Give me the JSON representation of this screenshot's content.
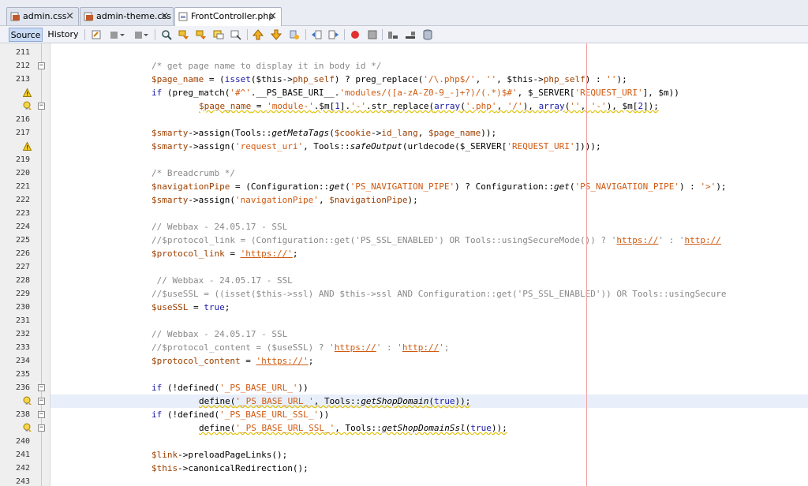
{
  "tabs": [
    {
      "label": "admin.css",
      "close": "×",
      "active": false
    },
    {
      "label": "admin-theme.css",
      "close": "×",
      "active": false
    },
    {
      "label": "FrontController.php",
      "close": "×",
      "active": true
    }
  ],
  "toolbar": {
    "source_label": "Source",
    "history_label": "History",
    "icons": [
      "last-edit-icon",
      "back-icon",
      "forward-icon",
      "find-selection-icon",
      "find-previous-icon",
      "find-next-icon",
      "toggle-highlight-icon",
      "toggle-rectangular-icon",
      "previous-bookmark-icon",
      "next-bookmark-icon",
      "toggle-bookmark-icon",
      "shift-left-icon",
      "shift-right-icon",
      "start-macro-icon",
      "stop-macro-icon",
      "comment-icon",
      "uncomment-icon",
      "database-icon"
    ]
  },
  "editor": {
    "line_numbers": [
      "211",
      "212",
      "213",
      "",
      "",
      "216",
      "217",
      "",
      "219",
      "220",
      "221",
      "222",
      "223",
      "224",
      "225",
      "226",
      "227",
      "228",
      "229",
      "230",
      "231",
      "232",
      "233",
      "234",
      "235",
      "236",
      "",
      "238",
      "",
      "240",
      "241",
      "242",
      "243"
    ],
    "warnings_lines": [
      3,
      7
    ],
    "hint_lines": [
      4,
      26,
      28
    ],
    "fold_lines": [
      1,
      4,
      25,
      26,
      27,
      28
    ]
  },
  "code": {
    "l211": "",
    "l212": "/* get page name to display it in body id */",
    "l213_a": "$page_name",
    "l213_b": " = (",
    "l213_c": "isset",
    "l213_d": "($this->",
    "l213_e": "php_self",
    "l213_f": ") ? preg_replace(",
    "l213_g": "'/\\.php$/'",
    "l213_h": ", ",
    "l213_i": "''",
    "l213_j": ", $this->",
    "l213_k": "php_self",
    "l213_l": ") : ",
    "l213_m": "''",
    "l213_n": ");",
    "l214_a": "if",
    "l214_b": " (preg_match(",
    "l214_c": "'#^'",
    "l214_d": ".__PS_BASE_URI__.",
    "l214_e": "'modules/([a-zA-Z0-9_-]+?)/(.*)$#'",
    "l214_f": ", $_SERVER[",
    "l214_g": "'REQUEST_URI'",
    "l214_h": "], $m))",
    "l215_a": "$page_name",
    "l215_b": " = ",
    "l215_c": "'module-'",
    "l215_d": ".$m[",
    "l215_e": "1",
    "l215_f": "].",
    "l215_g": "'-'",
    "l215_h": ".str_replace(",
    "l215_i": "array",
    "l215_j": "(",
    "l215_k": "'.php'",
    "l215_l": ", ",
    "l215_m": "'/'",
    "l215_n": "), ",
    "l215_o": "array",
    "l215_p": "(",
    "l215_q": "''",
    "l215_r": ", ",
    "l215_s": "'-'",
    "l215_t": "), $m[",
    "l215_u": "2",
    "l215_v": "]);",
    "l217_a": "$smarty",
    "l217_b": "->assign(Tools::",
    "l217_c": "getMetaTags",
    "l217_d": "(",
    "l217_e": "$cookie",
    "l217_f": "->",
    "l217_g": "id_lang",
    "l217_h": ", ",
    "l217_i": "$page_name",
    "l217_j": "));",
    "l218_a": "$smarty",
    "l218_b": "->assign(",
    "l218_c": "'request_uri'",
    "l218_d": ", Tools::",
    "l218_e": "safeOutput",
    "l218_f": "(urldecode($_SERVER[",
    "l218_g": "'REQUEST_URI'",
    "l218_h": "])));",
    "l220": "/* Breadcrumb */",
    "l221_a": "$navigationPipe",
    "l221_b": " = (Configuration::",
    "l221_c": "get",
    "l221_d": "(",
    "l221_e": "'PS_NAVIGATION_PIPE'",
    "l221_f": ") ? Configuration::",
    "l221_g": "get",
    "l221_h": "(",
    "l221_i": "'PS_NAVIGATION_PIPE'",
    "l221_j": ") : ",
    "l221_k": "'>'",
    "l221_l": ");",
    "l222_a": "$smarty",
    "l222_b": "->assign(",
    "l222_c": "'navigationPipe'",
    "l222_d": ", ",
    "l222_e": "$navigationPipe",
    "l222_f": ");",
    "l224": "// Webbax - 24.05.17 - SSL",
    "l225_a": "//$protocol_link = (Configuration::get('PS_SSL_ENABLED') OR Tools::usingSecureMode()) ? '",
    "l225_b": "https://",
    "l225_c": "' : '",
    "l225_d": "http://",
    "l226_a": "$protocol_link",
    "l226_b": " = ",
    "l226_c": "'https://'",
    "l226_d": ";",
    "l228": " // Webbax - 24.05.17 - SSL",
    "l229": "//$useSSL = ((isset($this->ssl) AND $this->ssl AND Configuration::get('PS_SSL_ENABLED')) OR Tools::usingSecure",
    "l230_a": "$useSSL",
    "l230_b": " = ",
    "l230_c": "true",
    "l230_d": ";",
    "l232": "// Webbax - 24.05.17 - SSL",
    "l233_a": "//$protocol_content = ($useSSL) ? '",
    "l233_b": "https://",
    "l233_c": "' : '",
    "l233_d": "http://",
    "l233_e": "';",
    "l234_a": "$protocol_content",
    "l234_b": " = ",
    "l234_c": "'https://'",
    "l234_d": ";",
    "l236_a": "if",
    "l236_b": " (!defined(",
    "l236_c": "'_PS_BASE_URL_'",
    "l236_d": "))",
    "l237_a": "define(",
    "l237_b": "'_PS_BASE_URL_'",
    "l237_c": ", Tools::",
    "l237_d": "getShopDomain",
    "l237_e": "(",
    "l237_f": "true",
    "l237_g": "));",
    "l238_a": "if",
    "l238_b": " (!defined(",
    "l238_c": "'_PS_BASE_URL_SSL_'",
    "l238_d": "))",
    "l239_a": "define(",
    "l239_b": "'_PS_BASE_URL_SSL_'",
    "l239_c": ", Tools::",
    "l239_d": "getShopDomainSsl",
    "l239_e": "(",
    "l239_f": "true",
    "l239_g": "));",
    "l241_a": "$link",
    "l241_b": "->preloadPageLinks();",
    "l242_a": "$this",
    "l242_b": "->canonicalRedirection();"
  }
}
